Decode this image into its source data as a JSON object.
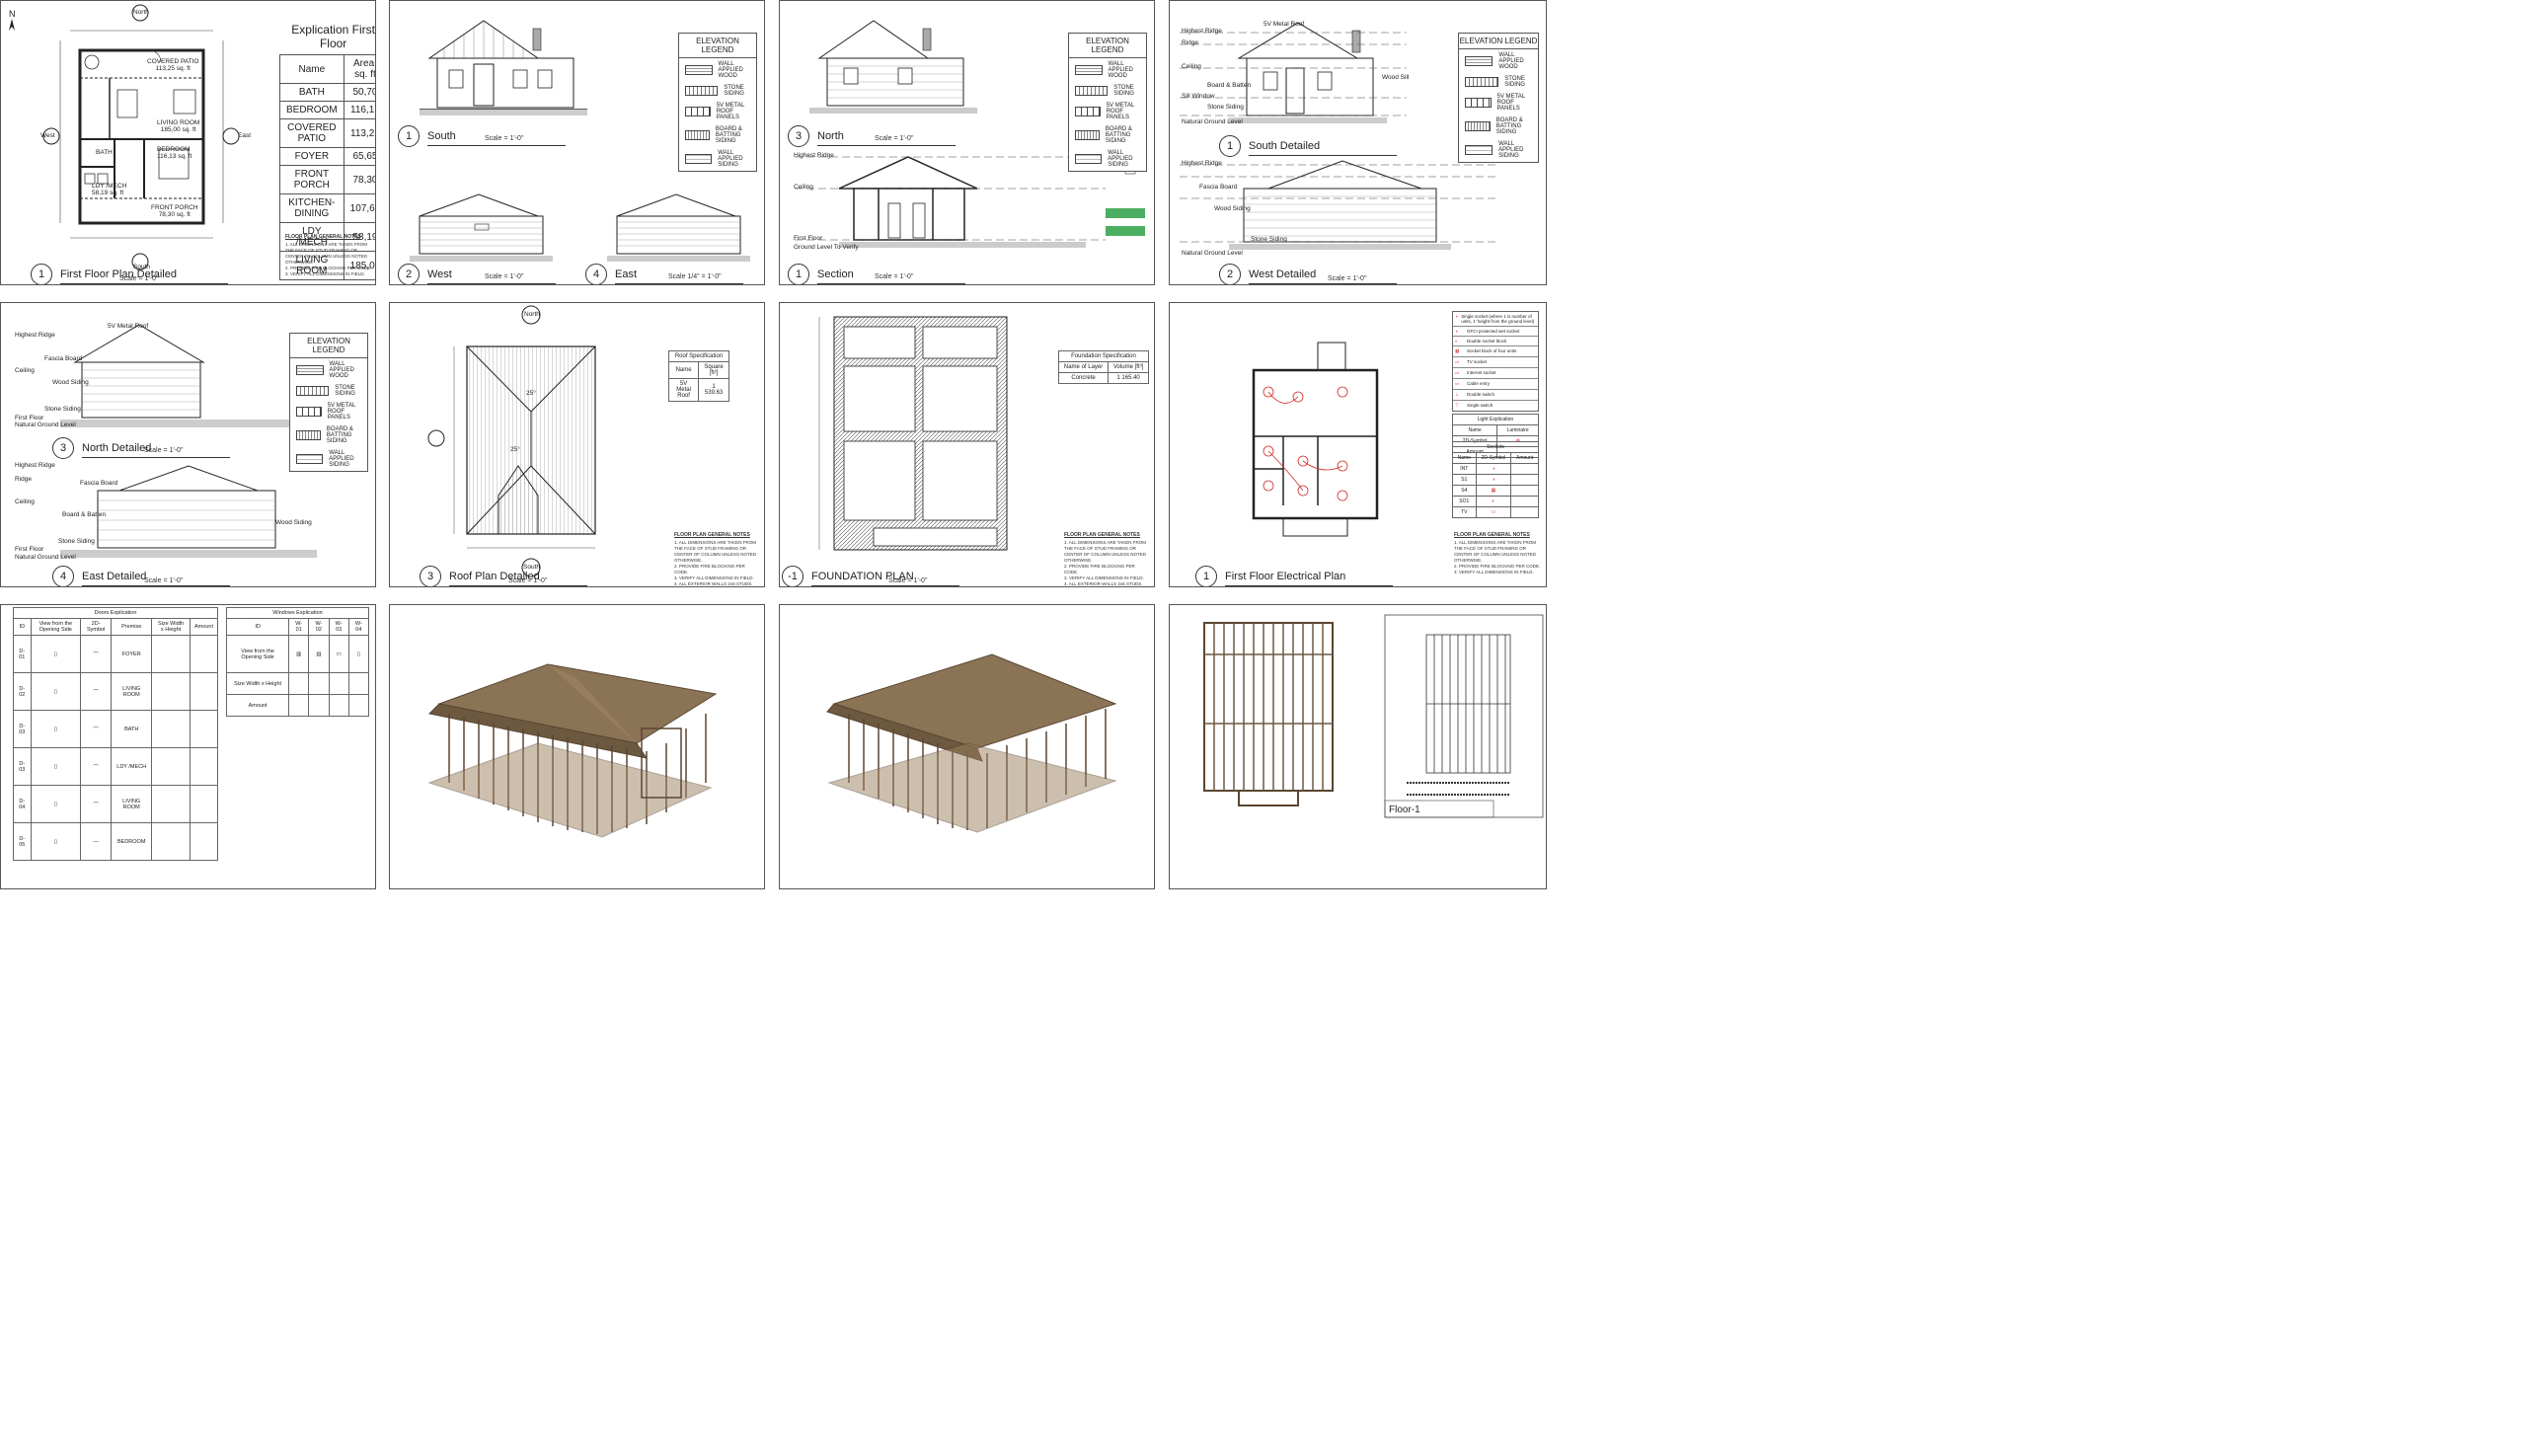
{
  "plan": {
    "title": "First Floor Plan Detailed",
    "number": "1",
    "scale": "Scale        =  1'-0\"",
    "north": "North",
    "south": "South",
    "west": "West",
    "east": "East",
    "north_arrow": "N",
    "rooms": [
      {
        "name": "COVERED PATIO",
        "area": "113,25 sq. ft"
      },
      {
        "name": "LIVING ROOM",
        "area": "185,00 sq. ft"
      },
      {
        "name": "BEDROOM",
        "area": "116,13 sq. ft"
      },
      {
        "name": "BATH",
        "area": ""
      },
      {
        "name": "FOYER",
        "area": "65,65 sq. ft"
      },
      {
        "name": "LDY /MECH",
        "area": "58,19 sq. ft"
      },
      {
        "name": "FRONT PORCH",
        "area": "78,30 sq. ft"
      },
      {
        "name": "KITCHEN-DINING",
        "area": "107,61 sq. ft"
      }
    ]
  },
  "explication": {
    "title": "Explication First Floor",
    "headers": [
      "Name",
      "Area, sq. ft"
    ],
    "rows": [
      [
        "BATH",
        "50,70"
      ],
      [
        "BEDROOM",
        "116,13"
      ],
      [
        "COVERED PATIO",
        "113,25"
      ],
      [
        "FOYER",
        "65,65"
      ],
      [
        "FRONT PORCH",
        "78,30"
      ],
      [
        "KITCHEN-DINING",
        "107,61"
      ],
      [
        "LDY /MECH",
        "58,19"
      ],
      [
        "LIVING ROOM",
        "185,00"
      ]
    ]
  },
  "notes": {
    "heading": "FLOOR PLAN GENERAL NOTES",
    "items": [
      "1.   ALL DIMENSIONS ARE TAKEN FROM THE FACE OF STUD FRAMING OR CENTER OF COLUMN UNLESS NOTED OTHERWISE.",
      "2.   PROVIDE FIRE BLOCKING PER CODE.",
      "3.   VERIFY ALL DIMENSIONS IN FIELD.",
      "4.   ALL EXTERIOR WALLS 2x6 STUDS.",
      "5.   ALL INTERIOR WALLS 2x4 STUDS.",
      "6.   COORDINATE ALL FINISHES WITH OWNER.",
      "7.   PROVIDE BLOCKING FOR ALL WALL MOUNTED ITEMS."
    ]
  },
  "elevation_legend": {
    "title": "ELEVATION LEGEND",
    "items": [
      "WALL APPLIED WOOD",
      "STONE SIDING",
      "5V METAL ROOF PANELS",
      "BOARD & BATTING SIDING",
      "WALL APPLIED SIDING"
    ]
  },
  "views": {
    "south": {
      "number": "1",
      "title": "South"
    },
    "west": {
      "number": "2",
      "title": "West"
    },
    "east": {
      "number": "4",
      "title": "East"
    },
    "north": {
      "number": "3",
      "title": "North"
    },
    "section": {
      "number": "1",
      "title": "Section"
    },
    "south_detailed": {
      "number": "1",
      "title": "South Detailed"
    },
    "west_detailed": {
      "number": "2",
      "title": "West Detailed"
    },
    "north_detailed": {
      "number": "3",
      "title": "North Detailed"
    },
    "east_detailed": {
      "number": "4",
      "title": "East Detailed"
    },
    "roof": {
      "number": "3",
      "title": "Roof Plan Detailed"
    },
    "foundation": {
      "number": "-1",
      "title": "FOUNDATION PLAN"
    },
    "electrical": {
      "number": "1",
      "title": "First Floor Electrical Plan"
    },
    "scale_short": "Scale        =  1'-0\"",
    "scale_east": "Scale   1/4\"  =  1'-0\""
  },
  "elevation_labels": {
    "highest_ridge": "Highest Ridge",
    "ridge": "Ridge",
    "ceiling": "Ceiling",
    "fascia_board": "Fascia Board",
    "wood_siding": "Wood Siding",
    "stone_siding": "Stone Siding",
    "first_floor": "First Floor",
    "natural_ground": "Natural Ground Level",
    "board_batten": "Board & Batten",
    "sill_window": "Sill Window",
    "metal_roof": "5V Metal Roof",
    "wood_sill": "Wood Sill",
    "ground_level": "Ground Level To Verify"
  },
  "roof": {
    "north": "North",
    "south": "South",
    "slope": "25°",
    "table": {
      "title": "Roof Specification",
      "headers": [
        "Name",
        "Square [ft²]"
      ],
      "rows": [
        [
          "5V Metal Roof",
          "1 539.63"
        ]
      ]
    }
  },
  "foundation": {
    "table": {
      "title": "Foundation Specification",
      "headers": [
        "Name of Layer",
        "Volume [ft³]"
      ],
      "rows": [
        [
          "Concrete",
          "1 165.40"
        ]
      ]
    }
  },
  "electrical": {
    "legend": [
      "Single socket (where 1 is number of units, 1' height from the ground level)",
      "GFCI protected wet socket",
      "Double socket block",
      "Socket block of four units",
      "TV socket",
      "Internet socket",
      "Cable entry",
      "Double switch",
      "Single switch"
    ],
    "light_title": "Light Explication",
    "light_headers": [
      "Name",
      "Luminaire"
    ],
    "light_rows": [
      [
        "2D-Symbol",
        ""
      ],
      [
        "Amount",
        ""
      ]
    ],
    "sockets_title": "Sockets",
    "sockets_headers": [
      "Name",
      "2D-Symbol",
      "Amount"
    ],
    "sockets_rows": [
      [
        "INT",
        ""
      ],
      [
        "S1",
        ""
      ],
      [
        "S4",
        ""
      ],
      [
        "SO1",
        ""
      ],
      [
        "TV",
        ""
      ]
    ]
  },
  "doors": {
    "title": "Doors Explication",
    "headers": [
      "ID",
      "View from the Opening Side",
      "2D-Symbol",
      "Premise",
      "Size Width x Height",
      "Amount"
    ],
    "rows": [
      [
        "D-01",
        "FOYER"
      ],
      [
        "D-02",
        "LIVING ROOM"
      ],
      [
        "D-03",
        "BATH"
      ],
      [
        "D-03",
        "LDY /MECH"
      ],
      [
        "D-04",
        "LIVING ROOM"
      ],
      [
        "D-05",
        "BEDROOM"
      ]
    ]
  },
  "windows": {
    "title": "Windows Explication",
    "headers": [
      "ID",
      "W-01",
      "W-02",
      "W-03",
      "W-04"
    ],
    "row_labels": [
      "View from the Opening Side",
      "Size Width x Height",
      "Amount"
    ]
  },
  "framing": {
    "sheet_title": "Floor-1"
  },
  "colors": {
    "line": "#333333",
    "wood": "#8b7355",
    "wood_dark": "#5a4632",
    "red": "#d22a2a",
    "green": "#1f9a3a"
  }
}
